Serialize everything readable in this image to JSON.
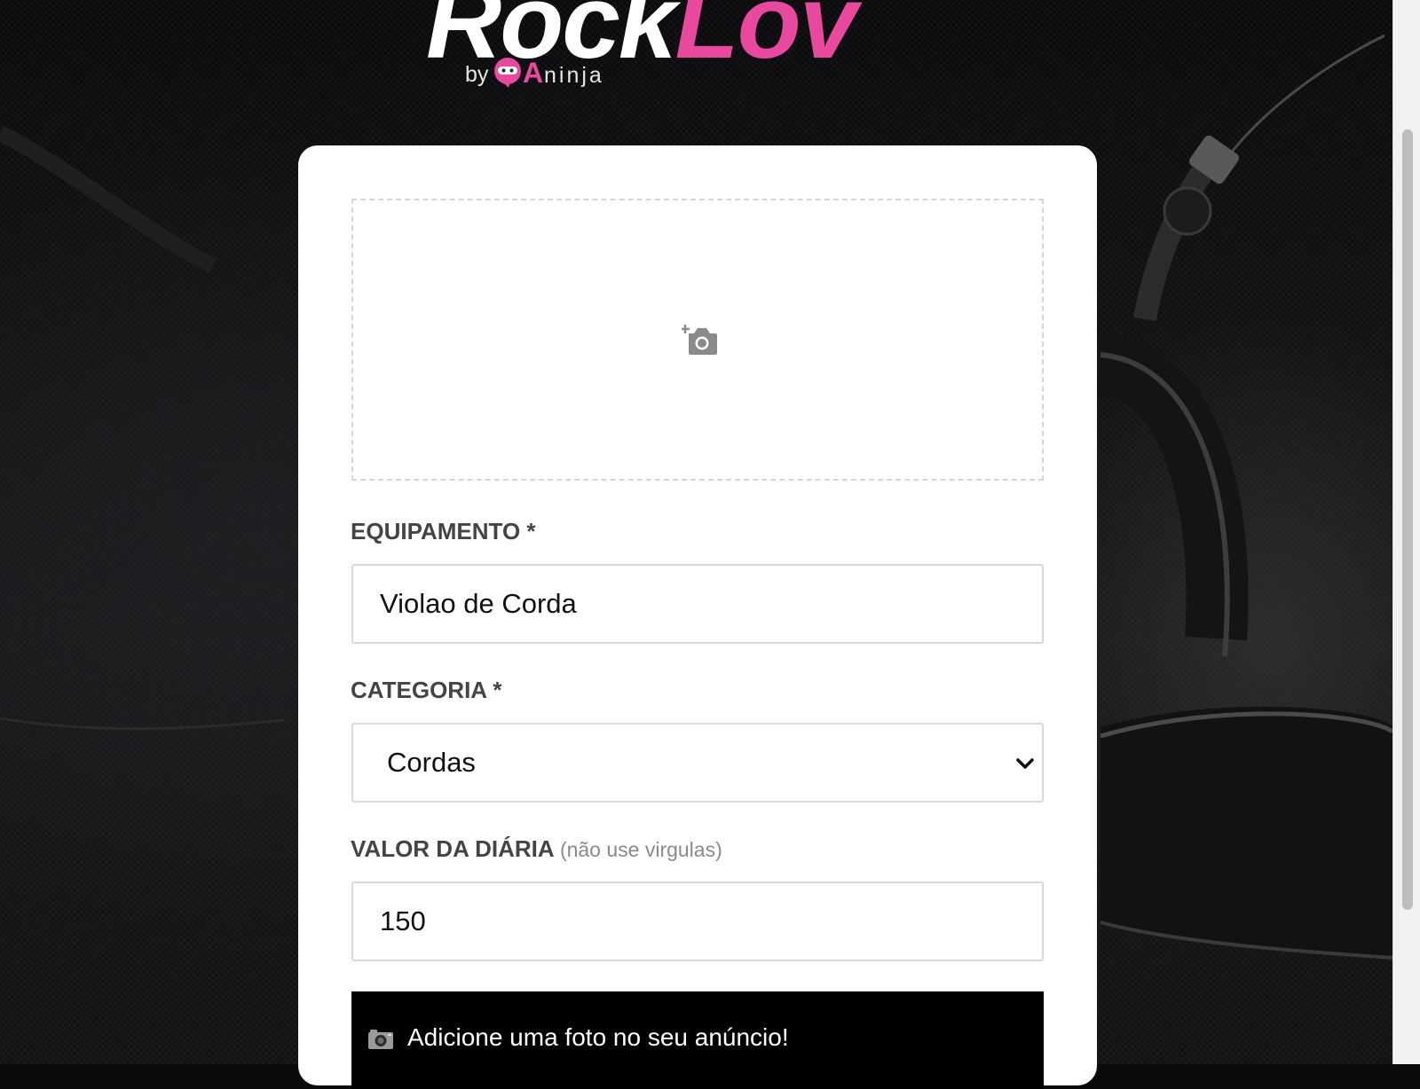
{
  "logo": {
    "word_part1": "Rock",
    "word_part2": "Lov",
    "by": "by",
    "qa": "A",
    "ninja": "ninja"
  },
  "form": {
    "photo_upload_icon": "camera-plus-icon",
    "equipamento": {
      "label": "EQUIPAMENTO *",
      "value": "Violao de Corda"
    },
    "categoria": {
      "label": "CATEGORIA *",
      "value": "Cordas"
    },
    "valor": {
      "label": "VALOR DA DIÁRIA",
      "hint": "(não use virgulas)",
      "value": "150"
    }
  },
  "alert": {
    "icon": "camera-icon",
    "message": "Adicione uma foto no seu anúncio!"
  },
  "colors": {
    "brand_pink": "#e8489d",
    "card": "#ffffff",
    "alert_bg": "#000000",
    "label": "#444444"
  }
}
